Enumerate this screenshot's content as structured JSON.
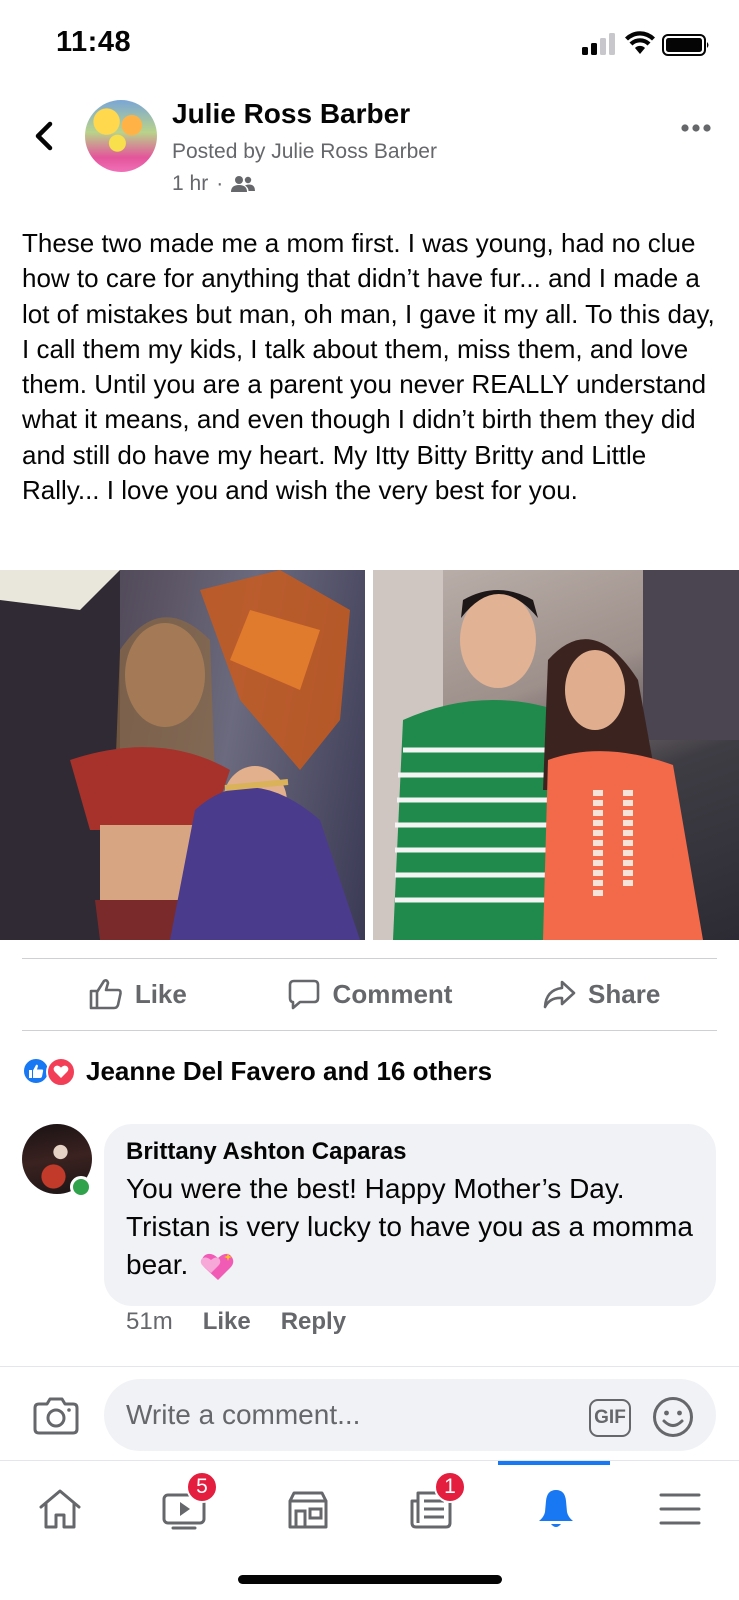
{
  "status_bar": {
    "time": "11:48"
  },
  "post": {
    "author": "Julie Ross Barber",
    "posted_by": "Posted by Julie Ross Barber",
    "time": "1 hr",
    "meta_separator": "·",
    "audience_icon": "friends-icon",
    "text": "These two made me a mom first. I was young, had no clue how to care for anything that didn’t have fur... and I made a lot of mistakes but man, oh man, I gave it my all. To this day, I call them my kids, I talk about them, miss them, and love them. Until you are a parent you never REALLY understand what it means, and even though I didn’t birth them they did and still do have my heart. My Itty Bitty Britty and Little Rally... I love you and wish the very best for you."
  },
  "actions": {
    "like": "Like",
    "comment": "Comment",
    "share": "Share"
  },
  "reactions": {
    "summary": "Jeanne Del Favero and 16 others",
    "types": [
      "like",
      "love"
    ]
  },
  "comments": [
    {
      "author": "Brittany Ashton Caparas",
      "text": "You were the best! Happy Mother’s Day. Tristan is very lucky to have you as a momma bear.",
      "emoji": "sparkling-heart",
      "time": "51m",
      "like_label": "Like",
      "reply_label": "Reply",
      "online": true
    }
  ],
  "composer": {
    "placeholder": "Write a comment...",
    "gif_label": "GIF"
  },
  "tab_bar": {
    "active": "notifications",
    "tabs": [
      {
        "name": "home",
        "icon": "home-icon",
        "badge": ""
      },
      {
        "name": "watch",
        "icon": "video-icon",
        "badge": "5"
      },
      {
        "name": "marketplace",
        "icon": "marketplace-icon",
        "badge": ""
      },
      {
        "name": "news",
        "icon": "news-icon",
        "badge": "1"
      },
      {
        "name": "notifications",
        "icon": "bell-icon",
        "badge": ""
      },
      {
        "name": "menu",
        "icon": "menu-icon",
        "badge": ""
      }
    ]
  },
  "colors": {
    "accent": "#1877f2",
    "secondary_text": "#65676b",
    "badge": "#e41e3f",
    "bubble": "#f0f2f5"
  }
}
